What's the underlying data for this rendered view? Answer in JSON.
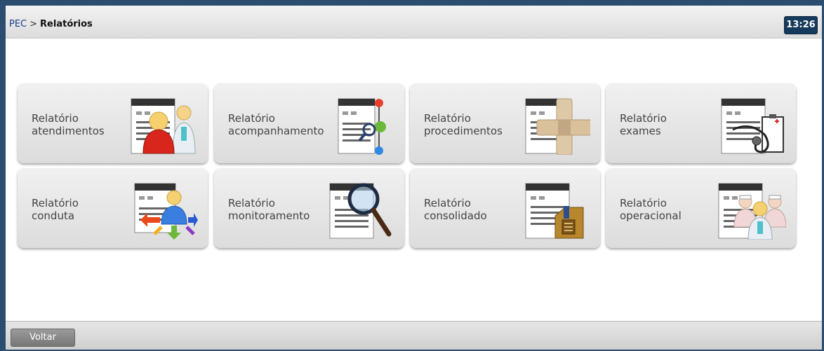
{
  "header": {
    "breadcrumb_root": "PEC",
    "breadcrumb_separator": ">",
    "breadcrumb_current": "Relatórios",
    "clock": "13:26"
  },
  "tiles": [
    {
      "line1": "Relatório",
      "line2": "atendimentos",
      "icon": "people-report-icon"
    },
    {
      "line1": "Relatório",
      "line2": "acompanhamento",
      "icon": "tracking-report-icon"
    },
    {
      "line1": "Relatório",
      "line2": "procedimentos",
      "icon": "bandage-report-icon"
    },
    {
      "line1": "Relatório",
      "line2": "exames",
      "icon": "stethoscope-report-icon"
    },
    {
      "line1": "Relatório",
      "line2": "conduta",
      "icon": "arrows-report-icon"
    },
    {
      "line1": "Relatório",
      "line2": "monitoramento",
      "icon": "magnifier-report-icon"
    },
    {
      "line1": "Relatório",
      "line2": "consolidado",
      "icon": "box-report-icon"
    },
    {
      "line1": "Relatório",
      "line2": "operacional",
      "icon": "staff-report-icon"
    }
  ],
  "footer": {
    "back_label": "Voltar"
  }
}
